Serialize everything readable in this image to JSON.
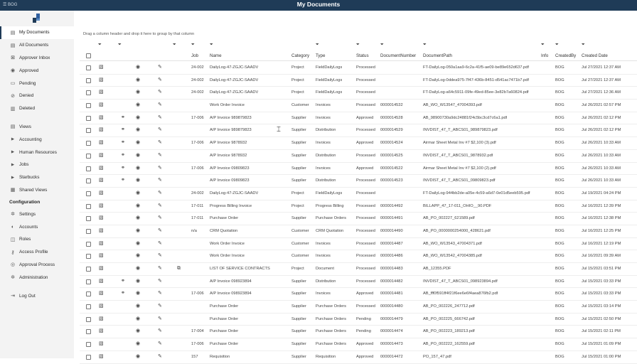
{
  "app": {
    "brand_small": "BOG",
    "title": "My Documents"
  },
  "sidebar": {
    "items": [
      {
        "label": "My Documents",
        "icon": "document-icon",
        "active": true
      },
      {
        "label": "All Documents",
        "icon": "documents-icon"
      },
      {
        "label": "Approver Inbox",
        "icon": "inbox-icon"
      },
      {
        "label": "Approved",
        "icon": "check-circle-icon"
      },
      {
        "label": "Pending",
        "icon": "pending-icon"
      },
      {
        "label": "Denied",
        "icon": "denied-icon"
      },
      {
        "label": "Deleted",
        "icon": "trash-icon"
      }
    ],
    "views": [
      {
        "label": "Views",
        "icon": "views-icon"
      },
      {
        "label": "Accounting",
        "icon": "caret-right-icon"
      },
      {
        "label": "Human Resources",
        "icon": "caret-right-icon"
      },
      {
        "label": "Jobs",
        "icon": "caret-right-icon"
      },
      {
        "label": "Starbucks",
        "icon": "caret-right-icon"
      },
      {
        "label": "Shared Views",
        "icon": "shared-views-icon"
      }
    ],
    "config_title": "Configuration",
    "config": [
      {
        "label": "Settings",
        "icon": "gear-icon"
      },
      {
        "label": "Accounts",
        "icon": "user-icon"
      },
      {
        "label": "Roles",
        "icon": "roles-icon"
      },
      {
        "label": "Access Profile",
        "icon": "key-icon"
      },
      {
        "label": "Approval Process",
        "icon": "approval-icon"
      },
      {
        "label": "Administration",
        "icon": "admin-icon"
      }
    ],
    "logout": {
      "label": "Log Out",
      "icon": "logout-icon"
    }
  },
  "grid": {
    "group_hint": "Drag a column header and drop it here to group by that column",
    "columns": [
      "Job",
      "Name",
      "Category",
      "Type",
      "Status",
      "DocumentNumber",
      "DocumentPath",
      "Info",
      "CreatedBy",
      "Created Date"
    ],
    "rows": [
      {
        "link": false,
        "copy": false,
        "job": "24-002",
        "name": "DailyLog-47-ZGJC-SAADV",
        "cat": "Project",
        "type": "FieldDailyLogs",
        "status": "Processed",
        "num": "",
        "path": "FT-DailyLog-050a1aa9-6c2a-41f5-ae09-be89e652d637.pdf",
        "by": "BOG",
        "date": "Jul 27/2021 12:37 AM"
      },
      {
        "link": false,
        "copy": false,
        "job": "24-002",
        "name": "DailyLog-47-ZGJC-SAADV",
        "cat": "Project",
        "type": "FieldDailyLogs",
        "status": "Processed",
        "num": "",
        "path": "FT-DailyLog-0ddea975-7f47-436b-8451-d541ac7471b7.pdf",
        "by": "BOG",
        "date": "Jul 27/2021 12:37 AM"
      },
      {
        "link": false,
        "copy": false,
        "job": "24-002",
        "name": "DailyLog-47-ZGJC-SAADV",
        "cat": "Project",
        "type": "FieldDailyLogs",
        "status": "Processed",
        "num": "",
        "path": "FT-DailyLog-a64c5911-09fe-49ed-85ee-3e82b7a60824.pdf",
        "by": "BOG",
        "date": "Jul 27/2021 12:36 AM"
      },
      {
        "link": false,
        "copy": false,
        "job": "",
        "name": "Work Order Invoice",
        "cat": "Customer",
        "type": "Invoices",
        "status": "Processed",
        "num": "0000014532",
        "path": "AB_WO_W13547_47004393.pdf",
        "by": "BOG",
        "date": "Jul 26/2021 02:57 PM"
      },
      {
        "link": true,
        "copy": false,
        "job": "17-006",
        "name": "A/P Invoice 989879823",
        "cat": "Supplier",
        "type": "Invoices",
        "status": "Approved",
        "num": "0000014528",
        "path": "AB_98900730a9dc24881f24c5bc3cd7c6a1.pdf",
        "by": "BOG",
        "date": "Jul 26/2021 02:12 PM"
      },
      {
        "link": true,
        "copy": false,
        "job": "",
        "name": "A/P Invoice 989879823",
        "cat": "Supplier",
        "type": "Distribution",
        "status": "Processed",
        "num": "0000014529",
        "path": "INVDIST_47_T_ABCS01_989879823.pdf",
        "by": "BOG",
        "date": "Jul 26/2021 02:12 PM"
      },
      {
        "link": true,
        "copy": false,
        "job": "17-006",
        "name": "A/P Invoice 9878932",
        "cat": "Supplier",
        "type": "Invoices",
        "status": "Approved",
        "num": "0000014524",
        "path": "Airmar Sheet Metal Inv #7 $2,100 (3).pdf",
        "by": "BOG",
        "date": "Jul 26/2021 10:33 AM"
      },
      {
        "link": true,
        "copy": false,
        "job": "",
        "name": "A/P Invoice 9878932",
        "cat": "Supplier",
        "type": "Distribution",
        "status": "Processed",
        "num": "0000014525",
        "path": "INVDIST_47_T_ABCS01_9878932.pdf",
        "by": "BOG",
        "date": "Jul 26/2021 10:33 AM"
      },
      {
        "link": true,
        "copy": false,
        "job": "17-006",
        "name": "A/P Invoice 09809823",
        "cat": "Supplier",
        "type": "Invoices",
        "status": "Approved",
        "num": "0000014522",
        "path": "Airmar Sheet Metal Inv #7 $2,100 (2).pdf",
        "by": "BOG",
        "date": "Jul 26/2021 10:33 AM"
      },
      {
        "link": true,
        "copy": false,
        "job": "",
        "name": "A/P Invoice 09809823",
        "cat": "Supplier",
        "type": "Distribution",
        "status": "Processed",
        "num": "0000014523",
        "path": "INVDIST_47_T_ABCS01_09809823.pdf",
        "by": "BOG",
        "date": "Jul 26/2021 10:33 AM"
      },
      {
        "link": false,
        "copy": false,
        "job": "24-002",
        "name": "DailyLog-47-ZGJC-SAADV",
        "cat": "Project",
        "type": "FieldDailyLogs",
        "status": "Processed",
        "num": "",
        "path": "FT-DailyLog-944bb2de-a05e-4c59-a6d7-0e01d5eeb595.pdf",
        "by": "BOG",
        "date": "Jul 19/2021 04:24 PM"
      },
      {
        "link": false,
        "copy": false,
        "job": "17-011",
        "name": "Progress Billing Invoice",
        "cat": "Project",
        "type": "Progress Billing",
        "status": "Processed",
        "num": "0000014492",
        "path": "BILLAPP_47_17-011_OHIO__90.PDF",
        "by": "BOG",
        "date": "Jul 16/2021 12:39 PM"
      },
      {
        "link": false,
        "copy": false,
        "job": "17-011",
        "name": "Purchase Order",
        "cat": "Supplier",
        "type": "Purchase Orders",
        "status": "Processed",
        "num": "0000014491",
        "path": "AB_PO_002227_621589.pdf",
        "by": "BOG",
        "date": "Jul 16/2021 12:38 PM"
      },
      {
        "link": false,
        "copy": false,
        "job": "n/a",
        "name": "CRM Quotation",
        "cat": "Customer",
        "type": "CRM Quotation",
        "status": "Processed",
        "num": "0000014490",
        "path": "AB_PO_0000000254000_428621.pdf",
        "by": "BOG",
        "date": "Jul 16/2021 12:25 PM"
      },
      {
        "link": false,
        "copy": false,
        "job": "",
        "name": "Work Order Invoice",
        "cat": "Customer",
        "type": "Invoices",
        "status": "Processed",
        "num": "0000014487",
        "path": "AB_WO_W13543_47004371.pdf",
        "by": "BOG",
        "date": "Jul 16/2021 12:19 PM"
      },
      {
        "link": false,
        "copy": false,
        "job": "",
        "name": "Work Order Invoice",
        "cat": "Customer",
        "type": "Invoices",
        "status": "Processed",
        "num": "0000014486",
        "path": "AB_WO_W13542_47004385.pdf",
        "by": "BOG",
        "date": "Jul 16/2021 09:39 AM"
      },
      {
        "link": false,
        "copy": true,
        "job": "",
        "name": "LIST OF SERVICE CONTRACTS",
        "cat": "Project",
        "type": "Document",
        "status": "Processed",
        "num": "0000014483",
        "path": "AB_12355.PDF",
        "by": "BOG",
        "date": "Jul 15/2021 03:51 PM"
      },
      {
        "link": true,
        "copy": false,
        "job": "",
        "name": "A/P Invoice 098923894",
        "cat": "Supplier",
        "type": "Distribution",
        "status": "Processed",
        "num": "0000014482",
        "path": "INVDIST_47_T_ABCS01_098923894.pdf",
        "by": "BOG",
        "date": "Jul 15/2021 03:33 PM"
      },
      {
        "link": true,
        "copy": false,
        "job": "17-006",
        "name": "A/P Invoice 098923894",
        "cat": "Supplier",
        "type": "Invoices",
        "status": "Approved",
        "num": "0000014481",
        "path": "AB_fff0f591ff4f21f6ee6e6f4aea876fb2.pdf",
        "by": "BOG",
        "date": "Jul 15/2021 03:33 PM"
      },
      {
        "link": false,
        "copy": false,
        "job": "",
        "name": "Purchase Order",
        "cat": "Supplier",
        "type": "Purchase Orders",
        "status": "Processed",
        "num": "0000014480",
        "path": "AB_PO_002226_247712.pdf",
        "by": "BOG",
        "date": "Jul 15/2021 03:14 PM"
      },
      {
        "link": false,
        "copy": false,
        "job": "",
        "name": "Purchase Order",
        "cat": "Supplier",
        "type": "Purchase Orders",
        "status": "Pending",
        "num": "0000014479",
        "path": "AB_PO_002225_666742.pdf",
        "by": "BOG",
        "date": "Jul 15/2021 02:50 PM"
      },
      {
        "link": false,
        "copy": false,
        "job": "17-004",
        "name": "Purchase Order",
        "cat": "Supplier",
        "type": "Purchase Orders",
        "status": "Pending",
        "num": "0000014474",
        "path": "AB_PO_002223_189213.pdf",
        "by": "BOG",
        "date": "Jul 15/2021 02:11 PM"
      },
      {
        "link": false,
        "copy": false,
        "job": "17-006",
        "name": "Purchase Order",
        "cat": "Supplier",
        "type": "Purchase Orders",
        "status": "Approved",
        "num": "0000014473",
        "path": "AB_PO_002222_162559.pdf",
        "by": "BOG",
        "date": "Jul 15/2021 01:09 PM"
      },
      {
        "link": false,
        "copy": false,
        "job": "157",
        "name": "Requisition",
        "cat": "Supplier",
        "type": "Requisition",
        "status": "Approved",
        "num": "0000014472",
        "path": "PO_157_47.pdf",
        "by": "BOG",
        "date": "Jul 15/2021 01:00 PM"
      }
    ]
  }
}
